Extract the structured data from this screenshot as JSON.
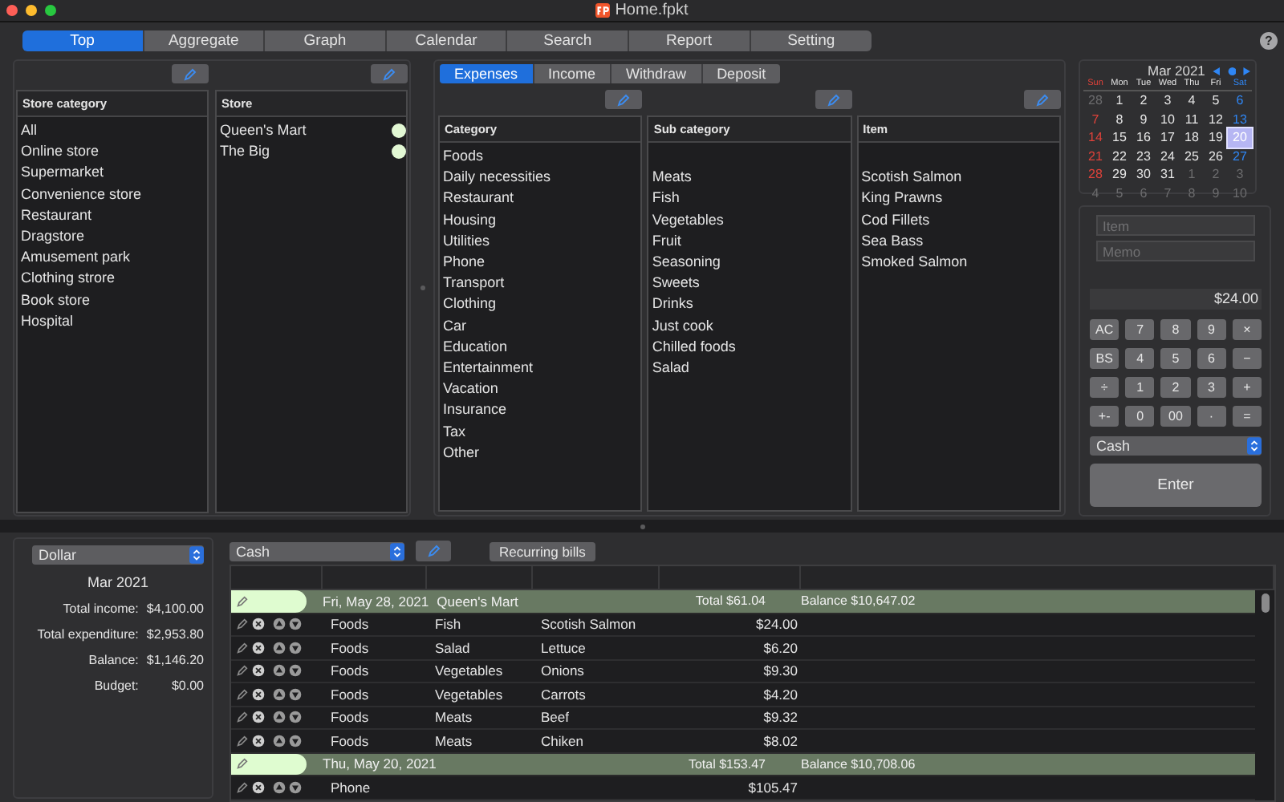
{
  "window": {
    "title": "Home.fpkt"
  },
  "main_tabs": [
    {
      "label": "Top",
      "selected": true
    },
    {
      "label": "Aggregate",
      "selected": false
    },
    {
      "label": "Graph",
      "selected": false
    },
    {
      "label": "Calendar",
      "selected": false
    },
    {
      "label": "Search",
      "selected": false
    },
    {
      "label": "Report",
      "selected": false
    },
    {
      "label": "Setting",
      "selected": false
    }
  ],
  "help": "?",
  "store_panel": {
    "category_header": "Store category",
    "categories": [
      "All",
      "Online store",
      "Supermarket",
      "Convenience store",
      "Restaurant",
      "Dragstore",
      "Amusement park",
      "Clothing strore",
      "Book store",
      "Hospital"
    ],
    "store_header": "Store",
    "stores": [
      {
        "name": "Queen's Mart",
        "color": "#e2f8d4"
      },
      {
        "name": "The Big",
        "color": "#e2f8d4"
      }
    ]
  },
  "type_tabs": [
    {
      "label": "Expenses",
      "selected": true
    },
    {
      "label": "Income",
      "selected": false
    },
    {
      "label": "Withdraw",
      "selected": false
    },
    {
      "label": "Deposit",
      "selected": false
    }
  ],
  "category_panel": {
    "category_header": "Category",
    "categories": [
      "Foods",
      "Daily necessities",
      "Restaurant",
      "Housing",
      "Utilities",
      "Phone",
      "Transport",
      "Clothing",
      "Car",
      "Education",
      "Entertainment",
      "Vacation",
      "Insurance",
      "Tax",
      "Other"
    ],
    "subcategory_header": "Sub category",
    "subcategories": [
      "Meats",
      "Fish",
      "Vegetables",
      "Fruit",
      "Seasoning",
      "Sweets",
      "Drinks",
      "Just cook",
      "Chilled foods",
      "Salad"
    ],
    "item_header": "Item",
    "items": [
      "Scotish Salmon",
      "King Prawns",
      "Cod Fillets",
      "Sea Bass",
      "Smoked Salmon"
    ]
  },
  "calendar": {
    "month": "Mar 2021",
    "weekdays": [
      {
        "label": "Sun",
        "kind": "sun"
      },
      {
        "label": "Mon",
        "kind": "day"
      },
      {
        "label": "Tue",
        "kind": "day"
      },
      {
        "label": "Wed",
        "kind": "day"
      },
      {
        "label": "Thu",
        "kind": "day"
      },
      {
        "label": "Fri",
        "kind": "day"
      },
      {
        "label": "Sat",
        "kind": "sat"
      }
    ],
    "days": [
      {
        "day": "28",
        "kind": "other",
        "selected": false
      },
      {
        "day": "1",
        "kind": "day",
        "selected": false
      },
      {
        "day": "2",
        "kind": "day",
        "selected": false
      },
      {
        "day": "3",
        "kind": "day",
        "selected": false
      },
      {
        "day": "4",
        "kind": "day",
        "selected": false
      },
      {
        "day": "5",
        "kind": "day",
        "selected": false
      },
      {
        "day": "6",
        "kind": "sat",
        "selected": false
      },
      {
        "day": "7",
        "kind": "sun",
        "selected": false
      },
      {
        "day": "8",
        "kind": "day",
        "selected": false
      },
      {
        "day": "9",
        "kind": "day",
        "selected": false
      },
      {
        "day": "10",
        "kind": "day",
        "selected": false
      },
      {
        "day": "11",
        "kind": "day",
        "selected": false
      },
      {
        "day": "12",
        "kind": "day",
        "selected": false
      },
      {
        "day": "13",
        "kind": "sat",
        "selected": false
      },
      {
        "day": "14",
        "kind": "sun",
        "selected": false
      },
      {
        "day": "15",
        "kind": "day",
        "selected": false
      },
      {
        "day": "16",
        "kind": "day",
        "selected": false
      },
      {
        "day": "17",
        "kind": "day",
        "selected": false
      },
      {
        "day": "18",
        "kind": "day",
        "selected": false
      },
      {
        "day": "19",
        "kind": "day",
        "selected": false
      },
      {
        "day": "20",
        "kind": "sat",
        "selected": true
      },
      {
        "day": "21",
        "kind": "sun",
        "selected": false
      },
      {
        "day": "22",
        "kind": "day",
        "selected": false
      },
      {
        "day": "23",
        "kind": "day",
        "selected": false
      },
      {
        "day": "24",
        "kind": "day",
        "selected": false
      },
      {
        "day": "25",
        "kind": "day",
        "selected": false
      },
      {
        "day": "26",
        "kind": "day",
        "selected": false
      },
      {
        "day": "27",
        "kind": "sat",
        "selected": false
      },
      {
        "day": "28",
        "kind": "sun",
        "selected": false
      },
      {
        "day": "29",
        "kind": "day",
        "selected": false
      },
      {
        "day": "30",
        "kind": "day",
        "selected": false
      },
      {
        "day": "31",
        "kind": "day",
        "selected": false
      },
      {
        "day": "1",
        "kind": "other",
        "selected": false
      },
      {
        "day": "2",
        "kind": "other",
        "selected": false
      },
      {
        "day": "3",
        "kind": "other",
        "selected": false
      },
      {
        "day": "4",
        "kind": "other",
        "selected": false
      },
      {
        "day": "5",
        "kind": "other",
        "selected": false
      },
      {
        "day": "6",
        "kind": "other",
        "selected": false
      },
      {
        "day": "7",
        "kind": "other",
        "selected": false
      },
      {
        "day": "8",
        "kind": "other",
        "selected": false
      },
      {
        "day": "9",
        "kind": "other",
        "selected": false
      },
      {
        "day": "10",
        "kind": "other",
        "selected": false
      }
    ]
  },
  "entry": {
    "item_placeholder": "Item",
    "memo_placeholder": "Memo",
    "amount": "$24.00",
    "keys": [
      "AC",
      "7",
      "8",
      "9",
      "×",
      "BS",
      "4",
      "5",
      "6",
      "−",
      "÷",
      "1",
      "2",
      "3",
      "+",
      "+-",
      "0",
      "00",
      "·",
      "="
    ],
    "payment": "Cash",
    "enter": "Enter"
  },
  "summary": {
    "currency": "Dollar",
    "month": "Mar 2021",
    "rows": [
      {
        "label": "Total income:",
        "value": "$4,100.00"
      },
      {
        "label": "Total expenditure:",
        "value": "$2,953.80"
      },
      {
        "label": "Balance:",
        "value": "$1,146.20"
      },
      {
        "label": "Budget:",
        "value": "$0.00"
      }
    ]
  },
  "ledger": {
    "account": "Cash",
    "recurring": "Recurring bills",
    "groups": [
      {
        "date": "Fri, May 28, 2021",
        "store": "Queen's Mart",
        "total": "Total $61.04",
        "balance": "Balance $10,647.02",
        "rows": [
          {
            "category": "Foods",
            "subcategory": "Fish",
            "item": "Scotish Salmon",
            "amount": "$24.00"
          },
          {
            "category": "Foods",
            "subcategory": "Salad",
            "item": "Lettuce",
            "amount": "$6.20"
          },
          {
            "category": "Foods",
            "subcategory": "Vegetables",
            "item": "Onions",
            "amount": "$9.30"
          },
          {
            "category": "Foods",
            "subcategory": "Vegetables",
            "item": "Carrots",
            "amount": "$4.20"
          },
          {
            "category": "Foods",
            "subcategory": "Meats",
            "item": "Beef",
            "amount": "$9.32"
          },
          {
            "category": "Foods",
            "subcategory": "Meats",
            "item": "Chiken",
            "amount": "$8.02"
          }
        ]
      },
      {
        "date": "Thu, May 20, 2021",
        "total": "Total $153.47",
        "balance": "Balance $10,708.06",
        "rows": [
          {
            "category": "Phone",
            "amount": "$105.47"
          }
        ]
      }
    ]
  }
}
